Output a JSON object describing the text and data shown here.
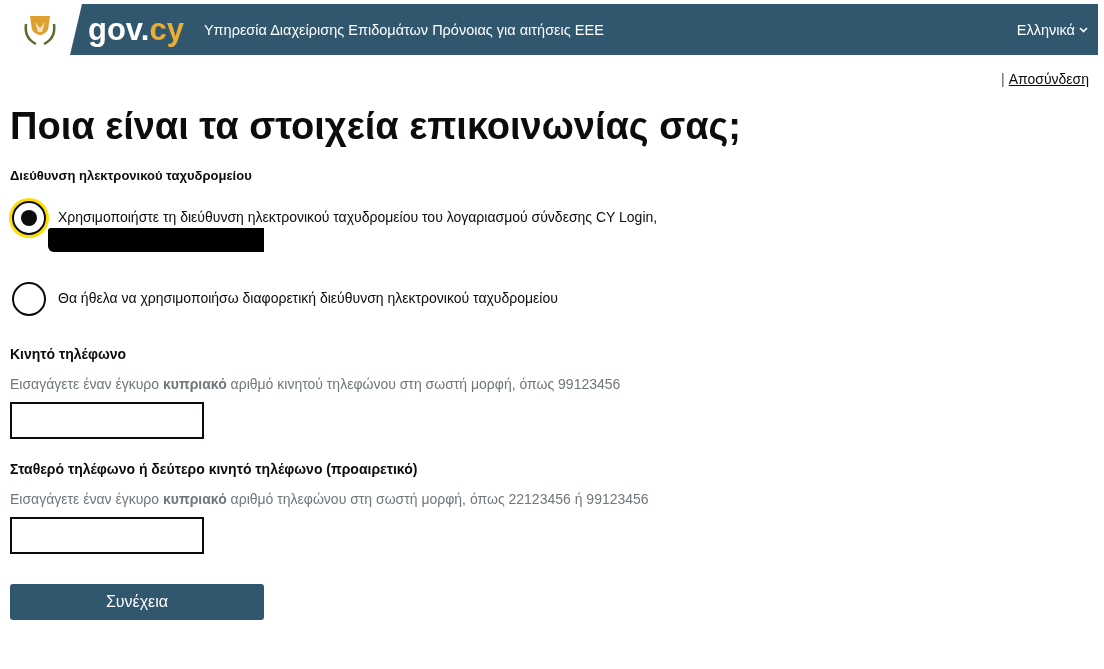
{
  "header": {
    "logo_main": "gov.",
    "logo_accent": "cy",
    "service_name": "Υπηρεσία Διαχείρισης Επιδομάτων Πρόνοιας για αιτήσεις ΕΕΕ",
    "language": "Ελληνικά"
  },
  "account_bar": {
    "separator": "|",
    "logout_link": "Αποσύνδεση"
  },
  "title": "Ποια είναι τα στοιχεία επικοινωνίας σας;",
  "email_section": {
    "label": "Διεύθυνση ηλεκτρονικού ταχυδρομείου",
    "options": [
      {
        "label": "Χρησιμοποιήστε τη διεύθυνση ηλεκτρονικού ταχυδρομείου του λογαριασμού σύνδεσης CY Login,",
        "selected": true,
        "focused": true,
        "redacted": true
      },
      {
        "label": "Θα ήθελα να χρησιμοποιήσω διαφορετική διεύθυνση ηλεκτρονικού ταχυδρομείου",
        "selected": false,
        "focused": false,
        "redacted": false
      }
    ]
  },
  "phone_fields": [
    {
      "label": "Κινητό τηλέφωνο",
      "hint": "Εισαγάγετε έναν έγκυρο **κυπριακό** αριθμό κινητού τηλεφώνου στη σωστή μορφή, όπως 99123456"
    },
    {
      "label": "Σταθερό τηλέφωνο ή δεύτερο κινητό τηλέφωνο (προαιρετικό)",
      "hint": "Εισαγάγετε έναν έγκυρο **κυπριακό** αριθμό τηλεφώνου στη σωστή μορφή, όπως 22123456 ή 99123456"
    }
  ],
  "continue_button": "Συνέχεια"
}
